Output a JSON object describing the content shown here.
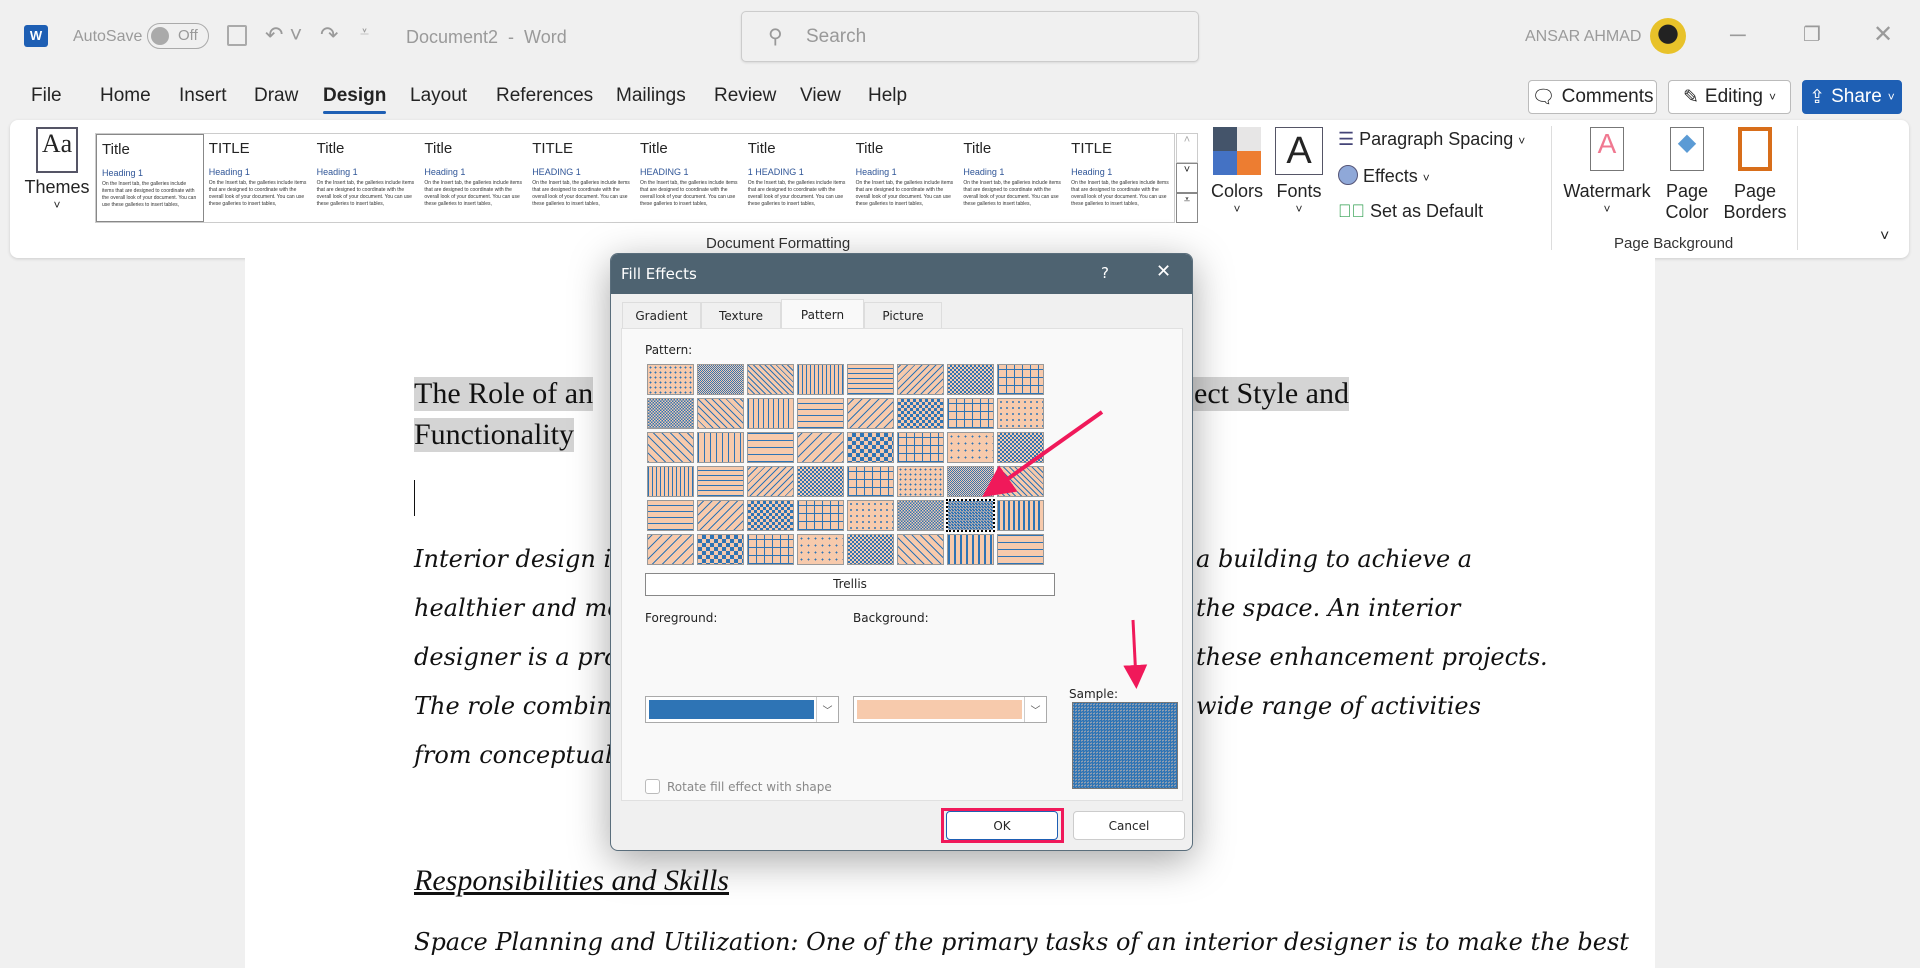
{
  "titlebar": {
    "autosave": "AutoSave",
    "toggle": "Off",
    "doc_title": "Document2  -  Word",
    "search_placeholder": "Search",
    "user": "ANSAR AHMAD"
  },
  "tabs": [
    "File",
    "Home",
    "Insert",
    "Draw",
    "Design",
    "Layout",
    "References",
    "Mailings",
    "Review",
    "View",
    "Help"
  ],
  "active_tab": "Design",
  "header_buttons": {
    "comments": "Comments",
    "editing": "Editing",
    "share": "Share"
  },
  "ribbon": {
    "themes": "Themes",
    "styles": [
      {
        "t": "Title",
        "h": "Heading 1"
      },
      {
        "t": "TITLE",
        "h": "Heading 1"
      },
      {
        "t": "Title",
        "h": "Heading 1"
      },
      {
        "t": "Title",
        "h": "Heading 1"
      },
      {
        "t": "TITLE",
        "h": "HEADING 1"
      },
      {
        "t": "Title",
        "h": "HEADING 1"
      },
      {
        "t": "Title",
        "h": "1  HEADING 1"
      },
      {
        "t": "Title",
        "h": "Heading 1"
      },
      {
        "t": "Title",
        "h": "Heading 1"
      },
      {
        "t": "TITLE",
        "h": "Heading 1"
      }
    ],
    "style_body": "On the Insert tab, the galleries include items that are designed to coordinate with the overall look of your document. You can use these galleries to insert tables,",
    "colors": "Colors",
    "fonts": "Fonts",
    "paragraph_spacing": "Paragraph Spacing",
    "effects": "Effects",
    "set_default": "Set as Default",
    "group_doc": "Document Formatting",
    "watermark": "Watermark",
    "page_color_1": "Page",
    "page_color_2": "Color",
    "page_borders_1": "Page",
    "page_borders_2": "Borders",
    "group_bg": "Page Background"
  },
  "document": {
    "heading_left": "The Role of an",
    "heading_right": "ect Style and",
    "heading_line2": "Functionality",
    "para_left": [
      "Interior design is",
      "healthier and more",
      "designer is a profe",
      "The role combines",
      "from conceptual de"
    ],
    "para_right": [
      "a building to achieve a",
      "the space. An interior",
      "these enhancement projects.",
      "wide range of activities",
      ""
    ],
    "subheading": "Responsibilities and Skills",
    "para2": "Space Planning and Utilization: One of the primary tasks of an interior designer is to make the best"
  },
  "dialog": {
    "title": "Fill Effects",
    "help": "?",
    "tabs": [
      "Gradient",
      "Texture",
      "Pattern",
      "Picture"
    ],
    "active_tab": "Pattern",
    "pattern_label": "Pattern:",
    "selected_pattern": "Trellis",
    "selected_index": 38,
    "foreground_label": "Foreground:",
    "background_label": "Background:",
    "foreground_color": "#2e74b5",
    "background_color": "#f7caac",
    "sample_label": "Sample:",
    "rotate_label": "Rotate fill effect with shape",
    "rotate_checked": false,
    "ok": "OK",
    "cancel": "Cancel"
  },
  "colors": {
    "accent": "#1e5fb4",
    "highlight": "#f0195a"
  }
}
